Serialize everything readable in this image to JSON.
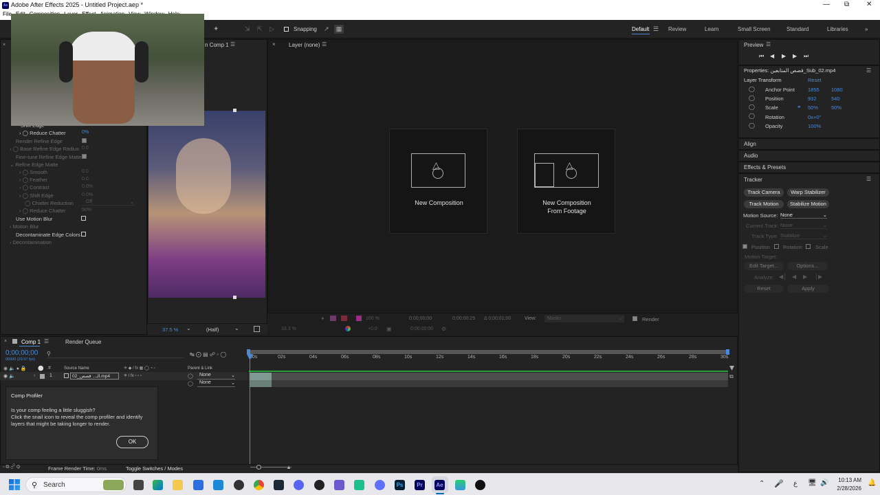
{
  "window": {
    "title": "Adobe After Effects 2025 - Untitled Project.aep *",
    "app_icon": "Ae"
  },
  "menubar": {
    "items": [
      "File",
      "Edit",
      "Composition",
      "Layer",
      "Effect",
      "Animation",
      "View",
      "Window",
      "Help"
    ]
  },
  "toolbar": {
    "snapping_label": "Snapping"
  },
  "workspaces": {
    "items": [
      "Default",
      "Review",
      "Learn",
      "Small Screen",
      "Standard",
      "Libraries"
    ],
    "active": "Default"
  },
  "comp_panel": {
    "tab": "n Comp 1",
    "zoom": "37.5 %",
    "resolution": "(Half)"
  },
  "effect_controls": {
    "rows": [
      {
        "label": "Shift Edge",
        "value": "",
        "dim": false
      },
      {
        "label": "Reduce Chatter",
        "value": "0%",
        "dim": false
      },
      {
        "label": "Render Refine Edge",
        "value": "",
        "dim": true
      },
      {
        "label": "Base Refine Edge Radius",
        "value": "0.0",
        "dim": true
      },
      {
        "label": "Fine-tune Refine Edge Matte",
        "value": "",
        "dim": true
      },
      {
        "label": "Refine Edge Matte",
        "value": "",
        "dim": true
      },
      {
        "label": "Smooth",
        "value": "0.0",
        "dim": true
      },
      {
        "label": "Feather",
        "value": "0.0",
        "dim": true
      },
      {
        "label": "Contrast",
        "value": "0.0%",
        "dim": true
      },
      {
        "label": "Shift Edge",
        "value": "0.0%",
        "dim": true
      },
      {
        "label": "Chatter Reduction",
        "value": "Off",
        "dim": true
      },
      {
        "label": "Reduce Chatter",
        "value": "50%",
        "dim": true
      },
      {
        "label": "Use Motion Blur",
        "value": "",
        "dim": false
      },
      {
        "label": "Motion Blur",
        "value": "",
        "dim": true
      },
      {
        "label": "Decontaminate Edge Colors",
        "value": "",
        "dim": false
      },
      {
        "label": "Decontamination",
        "value": "",
        "dim": true
      }
    ]
  },
  "layer_panel": {
    "tab": "Layer (none)",
    "new_comp": "New Composition",
    "new_comp_footage_1": "New Composition",
    "new_comp_footage_2": "From Footage",
    "zoom": "100 %",
    "time_start": "0;00;00;00",
    "time_end": "0;00:00:29",
    "duration": "Δ 0;00;01;00",
    "view_label": "View:",
    "view_value": "Masks",
    "render_label": "Render",
    "bottom_zoom": "33.3 %",
    "exposure": "+0.0",
    "bottom_time": "0;00;00;00"
  },
  "preview": {
    "title": "Preview"
  },
  "properties": {
    "title": "Properties: قصص المتابعين_Sub_02.mp4",
    "section": "Layer Transform",
    "reset": "Reset",
    "rows": [
      {
        "label": "Anchor Point",
        "v1": "1855",
        "v2": "1080"
      },
      {
        "label": "Position",
        "v1": "932",
        "v2": "540"
      },
      {
        "label": "Scale",
        "v1": "50%",
        "v2": "50%"
      },
      {
        "label": "Rotation",
        "v1": "0x+0°",
        "v2": ""
      },
      {
        "label": "Opacity",
        "v1": "100%",
        "v2": ""
      }
    ]
  },
  "side_panels": {
    "align": "Align",
    "audio": "Audio",
    "effects": "Effects & Presets",
    "tracker": "Tracker"
  },
  "tracker": {
    "track_camera": "Track Camera",
    "warp_stabilizer": "Warp Stabilizer",
    "track_motion": "Track Motion",
    "stabilize_motion": "Stabilize Motion",
    "motion_source_label": "Motion Source:",
    "motion_source_value": "None",
    "current_track_label": "Current Track:",
    "current_track_value": "None",
    "track_type_label": "Track Type:",
    "track_type_value": "Stabilize",
    "position": "Position",
    "rotation": "Rotation",
    "scale": "Scale",
    "motion_target": "Motion Target:",
    "edit_target": "Edit Target...",
    "options": "Options...",
    "analyze": "Analyze:",
    "reset": "Reset",
    "apply": "Apply"
  },
  "timeline": {
    "tab_comp": "Comp 1",
    "tab_render": "Render Queue",
    "timecode": "0;00;00;00",
    "fps": "00000 (29.97 fps)",
    "col_source": "Source Name",
    "col_parent": "Parent & Link",
    "layer_num": "1",
    "layer_name": "02_الـ... قصص.mp4",
    "parent_1": "None",
    "parent_2": "None",
    "ticks": [
      "00s",
      "02s",
      "04s",
      "06s",
      "08s",
      "10s",
      "12s",
      "14s",
      "16s",
      "18s",
      "20s",
      "22s",
      "24s",
      "26s",
      "28s",
      "30s"
    ],
    "frame_render": "Frame Render Time:",
    "frame_render_val": "0ms",
    "toggle": "Toggle Switches / Modes"
  },
  "comp_profiler": {
    "title": "Comp Profiler",
    "line1": "Is your comp feeling a little sluggish?",
    "line2": "Click the snail icon to reveal the comp profiler and identify",
    "line3": "layers that might be taking longer to render.",
    "ok": "OK"
  },
  "taskbar": {
    "search": "Search",
    "time": "10:13 AM",
    "date": "2/28/2026",
    "lang": "ع"
  }
}
